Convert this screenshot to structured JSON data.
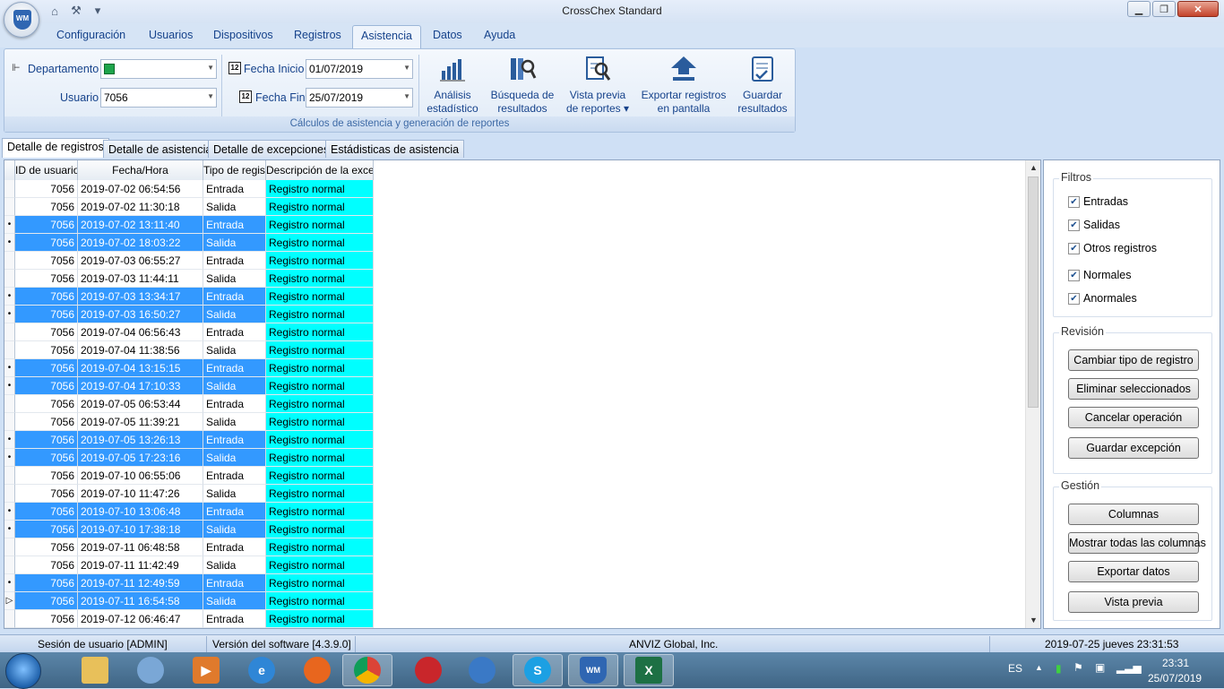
{
  "window": {
    "title": "CrossChex Standard",
    "logo_text": "WM"
  },
  "menu": [
    "Configuración",
    "Usuarios",
    "Dispositivos",
    "Registros",
    "Asistencia",
    "Datos",
    "Ayuda"
  ],
  "ribbon": {
    "departamento_label": "Departamento",
    "usuario_label": "Usuario",
    "usuario_value": "7056",
    "fecha_inicio_label": "Fecha Inicio",
    "fecha_inicio_value": "01/07/2019",
    "fecha_fin_label": "Fecha Fin",
    "fecha_fin_value": "25/07/2019",
    "buttons": [
      {
        "line1": "Análisis",
        "line2": "estadístico"
      },
      {
        "line1": "Búsqueda de",
        "line2": "resultados"
      },
      {
        "line1": "Vista previa",
        "line2": "de reportes ▾"
      },
      {
        "line1": "Exportar registros",
        "line2": "en pantalla"
      },
      {
        "line1": "Guardar",
        "line2": "resultados"
      }
    ],
    "group_caption": "Cálculos de asistencia y generación de reportes"
  },
  "tabs": [
    "Detalle de registros",
    "Detalle de asistencia",
    "Detalle de excepciones",
    "Estádisticas de asistencia"
  ],
  "grid": {
    "columns": [
      "ID de usuario",
      "Fecha/Hora",
      "Tipo de registro",
      "Descripción de la excepción"
    ],
    "rows": [
      {
        "id": "7056",
        "dt": "2019-07-02 06:54:56",
        "tipo": "Entrada",
        "desc": "Registro normal",
        "sel": false,
        "mark": ""
      },
      {
        "id": "7056",
        "dt": "2019-07-02 11:30:18",
        "tipo": "Salida",
        "desc": "Registro normal",
        "sel": false,
        "mark": ""
      },
      {
        "id": "7056",
        "dt": "2019-07-02 13:11:40",
        "tipo": "Entrada",
        "desc": "Registro normal",
        "sel": true,
        "mark": "•"
      },
      {
        "id": "7056",
        "dt": "2019-07-02 18:03:22",
        "tipo": "Salida",
        "desc": "Registro normal",
        "sel": true,
        "mark": "•"
      },
      {
        "id": "7056",
        "dt": "2019-07-03 06:55:27",
        "tipo": "Entrada",
        "desc": "Registro normal",
        "sel": false,
        "mark": ""
      },
      {
        "id": "7056",
        "dt": "2019-07-03 11:44:11",
        "tipo": "Salida",
        "desc": "Registro normal",
        "sel": false,
        "mark": ""
      },
      {
        "id": "7056",
        "dt": "2019-07-03 13:34:17",
        "tipo": "Entrada",
        "desc": "Registro normal",
        "sel": true,
        "mark": "•"
      },
      {
        "id": "7056",
        "dt": "2019-07-03 16:50:27",
        "tipo": "Salida",
        "desc": "Registro normal",
        "sel": true,
        "mark": "•"
      },
      {
        "id": "7056",
        "dt": "2019-07-04 06:56:43",
        "tipo": "Entrada",
        "desc": "Registro normal",
        "sel": false,
        "mark": ""
      },
      {
        "id": "7056",
        "dt": "2019-07-04 11:38:56",
        "tipo": "Salida",
        "desc": "Registro normal",
        "sel": false,
        "mark": ""
      },
      {
        "id": "7056",
        "dt": "2019-07-04 13:15:15",
        "tipo": "Entrada",
        "desc": "Registro normal",
        "sel": true,
        "mark": "•"
      },
      {
        "id": "7056",
        "dt": "2019-07-04 17:10:33",
        "tipo": "Salida",
        "desc": "Registro normal",
        "sel": true,
        "mark": "•"
      },
      {
        "id": "7056",
        "dt": "2019-07-05 06:53:44",
        "tipo": "Entrada",
        "desc": "Registro normal",
        "sel": false,
        "mark": ""
      },
      {
        "id": "7056",
        "dt": "2019-07-05 11:39:21",
        "tipo": "Salida",
        "desc": "Registro normal",
        "sel": false,
        "mark": ""
      },
      {
        "id": "7056",
        "dt": "2019-07-05 13:26:13",
        "tipo": "Entrada",
        "desc": "Registro normal",
        "sel": true,
        "mark": "•"
      },
      {
        "id": "7056",
        "dt": "2019-07-05 17:23:16",
        "tipo": "Salida",
        "desc": "Registro normal",
        "sel": true,
        "mark": "•"
      },
      {
        "id": "7056",
        "dt": "2019-07-10 06:55:06",
        "tipo": "Entrada",
        "desc": "Registro normal",
        "sel": false,
        "mark": ""
      },
      {
        "id": "7056",
        "dt": "2019-07-10 11:47:26",
        "tipo": "Salida",
        "desc": "Registro normal",
        "sel": false,
        "mark": ""
      },
      {
        "id": "7056",
        "dt": "2019-07-10 13:06:48",
        "tipo": "Entrada",
        "desc": "Registro normal",
        "sel": true,
        "mark": "•"
      },
      {
        "id": "7056",
        "dt": "2019-07-10 17:38:18",
        "tipo": "Salida",
        "desc": "Registro normal",
        "sel": true,
        "mark": "•"
      },
      {
        "id": "7056",
        "dt": "2019-07-11 06:48:58",
        "tipo": "Entrada",
        "desc": "Registro normal",
        "sel": false,
        "mark": ""
      },
      {
        "id": "7056",
        "dt": "2019-07-11 11:42:49",
        "tipo": "Salida",
        "desc": "Registro normal",
        "sel": false,
        "mark": ""
      },
      {
        "id": "7056",
        "dt": "2019-07-11 12:49:59",
        "tipo": "Entrada",
        "desc": "Registro normal",
        "sel": true,
        "mark": "•"
      },
      {
        "id": "7056",
        "dt": "2019-07-11 16:54:58",
        "tipo": "Salida",
        "desc": "Registro normal",
        "sel": true,
        "mark": "▷"
      },
      {
        "id": "7056",
        "dt": "2019-07-12 06:46:47",
        "tipo": "Entrada",
        "desc": "Registro normal",
        "sel": false,
        "mark": ""
      }
    ]
  },
  "side": {
    "filtros_title": "Filtros",
    "filtros": [
      "Entradas",
      "Salidas",
      "Otros registros",
      "Normales",
      "Anormales"
    ],
    "revision_title": "Revisión",
    "revision_buttons": [
      "Cambiar tipo de registro",
      "Eliminar seleccionados",
      "Cancelar operación",
      "Guardar excepción"
    ],
    "gestion_title": "Gestión",
    "gestion_buttons": [
      "Columnas",
      "Mostrar todas las columnas",
      "Exportar datos",
      "Vista previa"
    ]
  },
  "status": {
    "session": "Sesión de usuario  [ADMIN]",
    "version": "Versión del software  [4.3.9.0]",
    "company": "ANVIZ Global, Inc.",
    "datetime": "2019-07-25 jueves 23:31:53"
  },
  "taskbar": {
    "lang": "ES",
    "time": "23:31",
    "date": "25/07/2019"
  },
  "colors": {
    "selection": "#3399ff",
    "exception_cell": "#00ffff",
    "ribbon_text": "#15428b"
  }
}
